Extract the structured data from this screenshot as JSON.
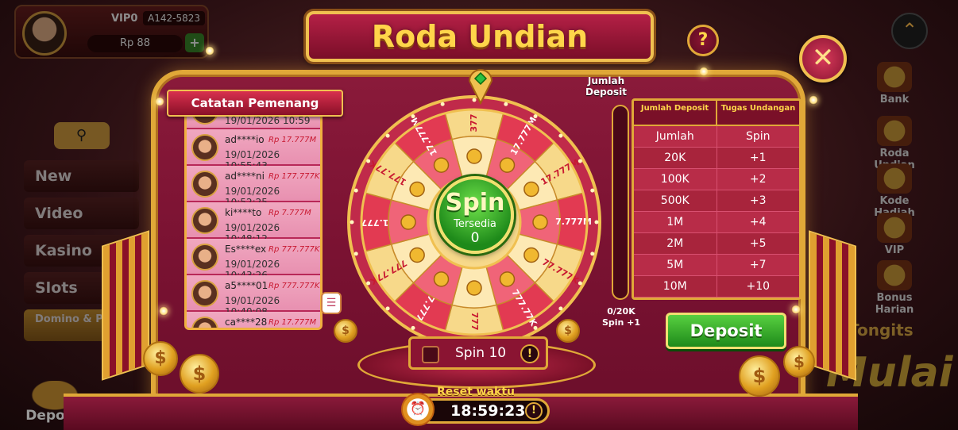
{
  "profile": {
    "vip": "VIP0",
    "account": "A142-5823",
    "balance": "Rp 88",
    "add": "+"
  },
  "side_menu": {
    "search_icon": "search-icon",
    "items": [
      {
        "label": "New",
        "icon": "gear-icon"
      },
      {
        "label": "Video",
        "icon": "video-icon"
      },
      {
        "label": "Kasino",
        "icon": "dice-icon"
      },
      {
        "label": "Slots",
        "icon": "slot-icon"
      },
      {
        "label": "Domino & Poker",
        "icon": "domino-icon"
      }
    ],
    "deposit_label": "Deposit"
  },
  "right_menu": {
    "items": [
      {
        "label": "Bank"
      },
      {
        "label": "Roda Undian"
      },
      {
        "label": "Kode Hadiah"
      },
      {
        "label": "VIP"
      },
      {
        "label": "Bonus Harian"
      }
    ],
    "tongits": "Tongits",
    "mulai": "Mulai"
  },
  "dialog": {
    "title": "Roda Undian",
    "help": "?",
    "close": "✕"
  },
  "winners": {
    "title": "Catatan Pemenang",
    "rows": [
      {
        "name": "",
        "amount": "",
        "time": "19/01/2026 10:59"
      },
      {
        "name": "ad****io",
        "amount": "Rp 17.777M",
        "time": "19/01/2026 10:55:43"
      },
      {
        "name": "ad****ni",
        "amount": "Rp 177.777K",
        "time": "19/01/2026 10:52:25"
      },
      {
        "name": "ki****to",
        "amount": "Rp 7.777M",
        "time": "19/01/2026 10:48:12"
      },
      {
        "name": "Es****ex",
        "amount": "Rp 777.777K",
        "time": "19/01/2026 10:43:26"
      },
      {
        "name": "a5****01",
        "amount": "Rp 777.777K",
        "time": "19/01/2026 10:40:08"
      },
      {
        "name": "ca****28",
        "amount": "Rp 17.777M",
        "time": ""
      }
    ]
  },
  "wheel": {
    "segments": [
      "377",
      "17.777M",
      "17.777M",
      "7.777M",
      "77.777K",
      "777.77K",
      "777",
      "7.777",
      "777.77K",
      "1.777",
      "177.77K",
      "17.777M"
    ],
    "spin_label": "Spin",
    "available_label": "Tersedia",
    "available_count": "0"
  },
  "spin10": {
    "label": "Spin 10",
    "info": "!"
  },
  "timer": {
    "reset_label": "Reset waktu",
    "value": "18:59:23",
    "info": "!"
  },
  "deposit_progress": {
    "title": "Jumlah Deposit",
    "progress_text": "0/20K",
    "bonus_text": "Spin +1",
    "fraction": 0
  },
  "deposit_table": {
    "col1_header": "Jumlah Deposit",
    "col2_header": "Tugas Undangan",
    "sub1": "Jumlah",
    "sub2": "Spin",
    "rows": [
      {
        "amount": "20K",
        "spin": "+1"
      },
      {
        "amount": "100K",
        "spin": "+2"
      },
      {
        "amount": "500K",
        "spin": "+3"
      },
      {
        "amount": "1M",
        "spin": "+4"
      },
      {
        "amount": "2M",
        "spin": "+5"
      },
      {
        "amount": "5M",
        "spin": "+7"
      },
      {
        "amount": "10M",
        "spin": "+10"
      }
    ]
  },
  "deposit_button": "Deposit",
  "colors": {
    "gold": "#e0a838",
    "panel": "#8a1a3a",
    "green": "#1e8a1a"
  }
}
